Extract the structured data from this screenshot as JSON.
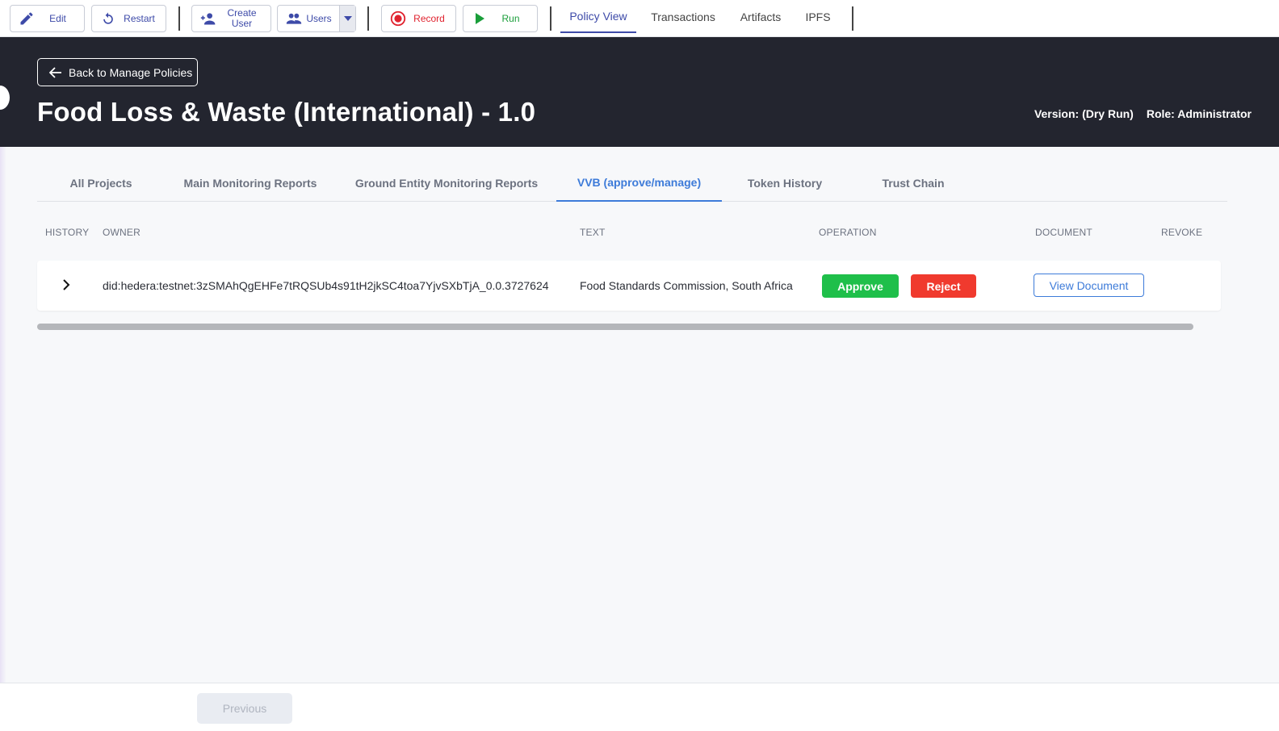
{
  "toolbar": {
    "edit": "Edit",
    "restart": "Restart",
    "create_user": "Create User",
    "users": "Users",
    "record": "Record",
    "run": "Run",
    "nav": [
      "Policy View",
      "Transactions",
      "Artifacts",
      "IPFS"
    ],
    "active_nav": "Policy View"
  },
  "header": {
    "back_label": "Back to Manage Policies",
    "title": "Food Loss & Waste (International) - 1.0",
    "version": "Version: (Dry Run)",
    "role": "Role: Administrator"
  },
  "subtabs": [
    "All Projects",
    "Main Monitoring Reports",
    "Ground Entity Monitoring Reports",
    "VVB (approve/manage)",
    "Token History",
    "Trust Chain"
  ],
  "active_subtab": "VVB (approve/manage)",
  "table": {
    "columns": [
      "HISTORY",
      "OWNER",
      "TEXT",
      "OPERATION",
      "DOCUMENT",
      "REVOKE"
    ],
    "rows": [
      {
        "owner": "did:hedera:testnet:3zSMAhQgEHFe7tRQSUb4s91tH2jkSC4toa7YjvSXbTjA_0.0.3727624",
        "text": "Food Standards Commission, South Africa",
        "approve": "Approve",
        "reject": "Reject",
        "document": "View Document"
      }
    ]
  },
  "footer": {
    "previous": "Previous"
  },
  "colors": {
    "accent": "#3d4aa8",
    "link": "#3d7bd9",
    "approve": "#1fbf4a",
    "reject": "#f03a2e",
    "header_bg": "#23252f"
  }
}
